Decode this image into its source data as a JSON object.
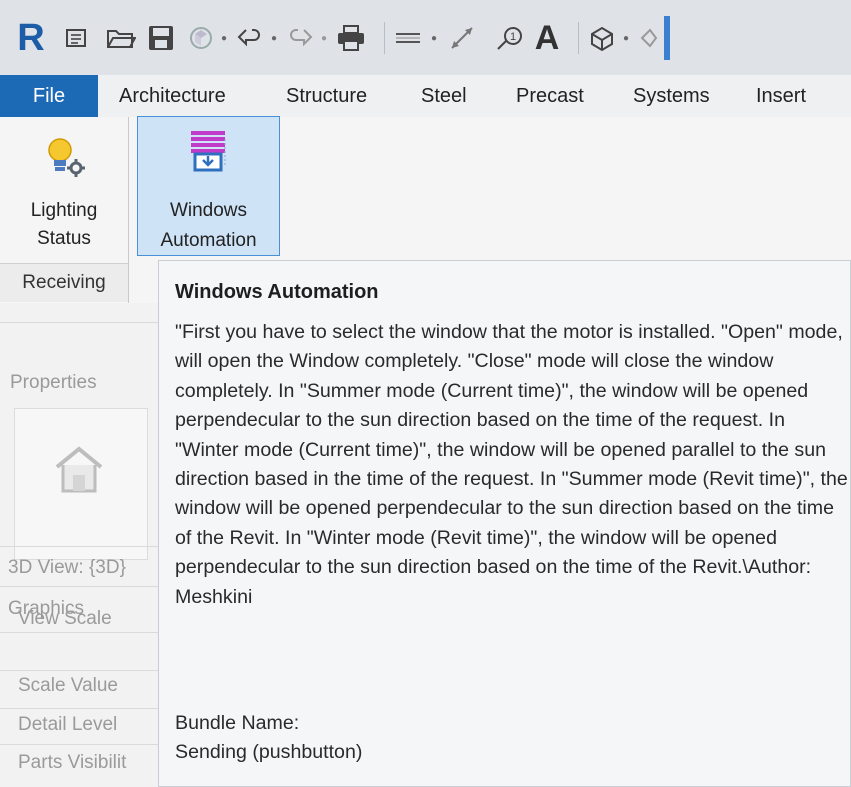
{
  "colors": {
    "file_tab": "#1c69b6",
    "accent_border": "#4a90d9",
    "selected_bg": "#cfe3f7"
  },
  "quick_access": {
    "logo": "R",
    "icons": [
      "info-center-icon",
      "open-folder-icon",
      "save-icon",
      "sync-icon",
      "dropdown-caret-icon",
      "undo-icon",
      "dropdown-caret-icon",
      "redo-icon",
      "dropdown-caret-icon",
      "print-icon",
      "measure-icon",
      "dropdown-caret-icon",
      "aligned-dimension-icon",
      "tag-icon",
      "text-icon",
      "3d-view-icon",
      "dropdown-caret-icon",
      "section-icon"
    ]
  },
  "tabs": [
    {
      "label": "File"
    },
    {
      "label": "Architecture"
    },
    {
      "label": "Structure"
    },
    {
      "label": "Steel"
    },
    {
      "label": "Precast"
    },
    {
      "label": "Systems"
    },
    {
      "label": "Insert"
    }
  ],
  "ribbon": {
    "lighting_status": {
      "line1": "Lighting",
      "line2": "Status"
    },
    "windows_automation": {
      "line1": "Windows",
      "line2": "Automation"
    },
    "panel_label": "Receiving"
  },
  "properties": {
    "title": "Properties",
    "view_type": "3D View: {3D}",
    "category": "Graphics",
    "rows": [
      "View Scale",
      "Scale Value",
      "Detail Level",
      "Parts Visibilit"
    ]
  },
  "tooltip": {
    "title": "Windows Automation",
    "description": "\"First you have to select the window that the motor is installed. \"Open\" mode, will open the Window completely. \"Close\" mode will close the window completely. In \"Summer mode (Current time)\", the window will be opened perpendecular to the sun direction based on the time of the request. In \"Winter mode (Current time)\", the window will be opened parallel to the sun direction based in the time of the request. In \"Summer mode (Revit time)\", the window will be opened perpendecular to the sun direction based on the time of the Revit. In \"Winter mode (Revit time)\", the window will be opened perpendecular to the sun direction based on the time of the Revit.\\Author: Meshkini",
    "bundle_label": "Bundle Name:",
    "bundle_value": "Sending (pushbutton)"
  }
}
